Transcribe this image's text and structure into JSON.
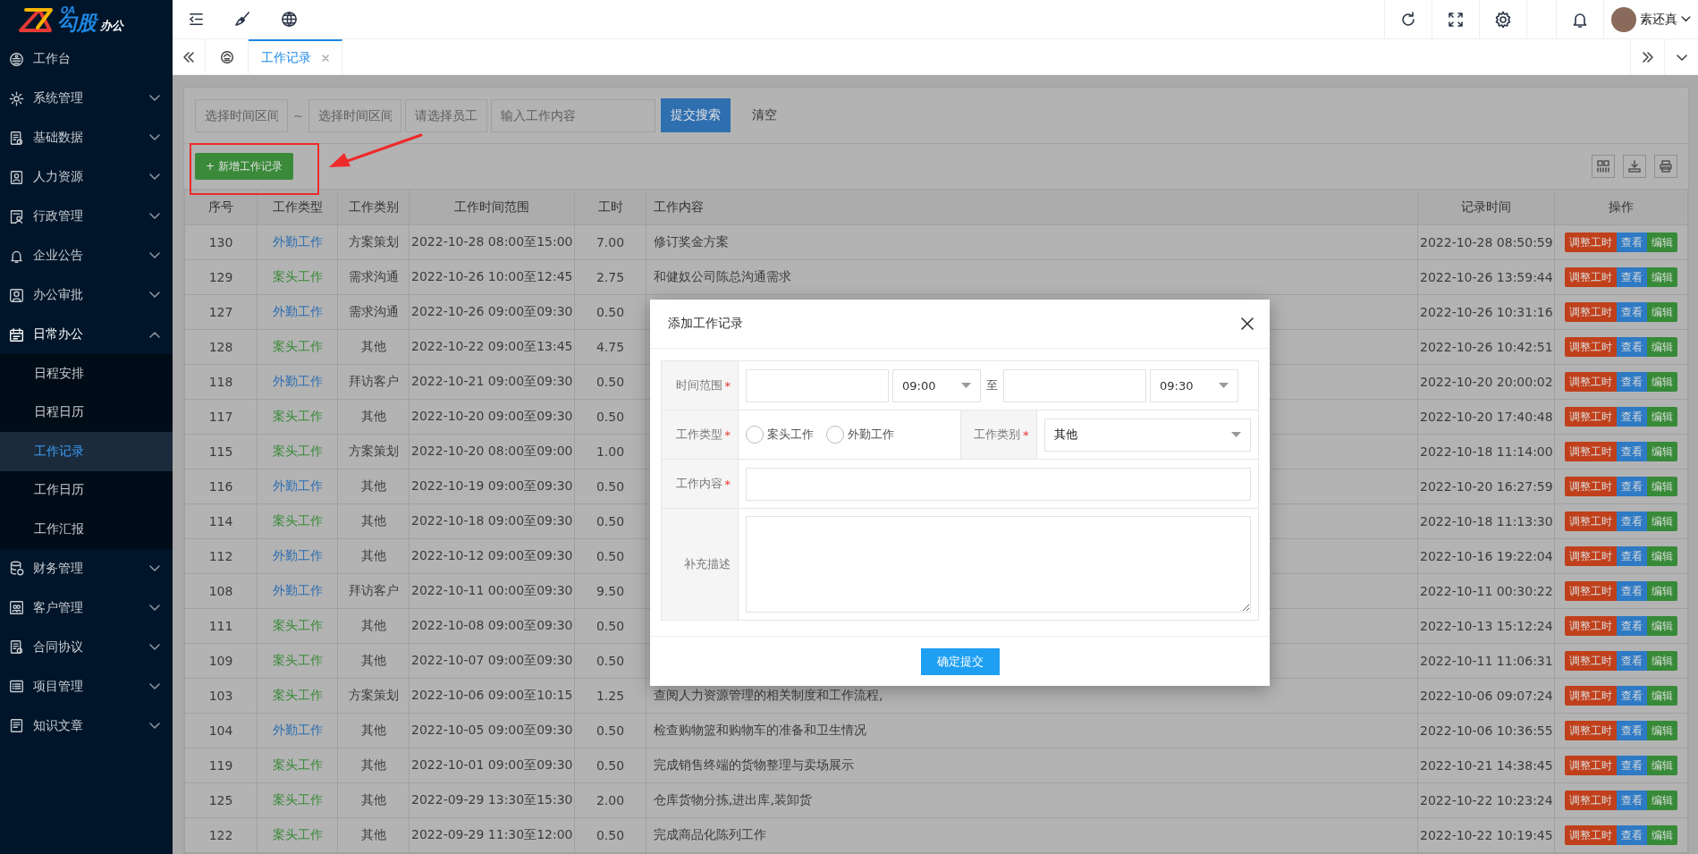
{
  "logo": {
    "mark": "OA",
    "name": "勾股",
    "suffix": "办公"
  },
  "sidebar": {
    "items": [
      {
        "label": "工作台",
        "expanded": false
      },
      {
        "label": "系统管理",
        "expanded": false
      },
      {
        "label": "基础数据",
        "expanded": false
      },
      {
        "label": "人力资源",
        "expanded": false
      },
      {
        "label": "行政管理",
        "expanded": false
      },
      {
        "label": "企业公告",
        "expanded": false
      },
      {
        "label": "办公审批",
        "expanded": false
      },
      {
        "label": "日常办公",
        "expanded": true,
        "children": [
          {
            "label": "日程安排",
            "selected": false
          },
          {
            "label": "日程日历",
            "selected": false
          },
          {
            "label": "工作记录",
            "selected": true
          },
          {
            "label": "工作日历",
            "selected": false
          },
          {
            "label": "工作汇报",
            "selected": false
          }
        ]
      },
      {
        "label": "财务管理",
        "expanded": false
      },
      {
        "label": "客户管理",
        "expanded": false
      },
      {
        "label": "合同协议",
        "expanded": false
      },
      {
        "label": "项目管理",
        "expanded": false
      },
      {
        "label": "知识文章",
        "expanded": false
      }
    ]
  },
  "header": {
    "user": "素还真"
  },
  "tabs": [
    {
      "label": "工作记录",
      "selected": true
    }
  ],
  "filters": {
    "start": {
      "placeholder": "选择时间区间"
    },
    "separator": "~",
    "end": {
      "placeholder": "选择时间区间"
    },
    "employee": {
      "placeholder": "请选择员工"
    },
    "content": {
      "placeholder": "输入工作内容"
    },
    "search_button": "提交搜索",
    "clear_button": "清空"
  },
  "add_button": "+ 新增工作记录",
  "table": {
    "columns": [
      "序号",
      "工作类型",
      "工作类别",
      "工作时间范围",
      "工时",
      "工作内容",
      "记录时间",
      "操作"
    ],
    "rows": [
      {
        "id": "130",
        "type": {
          "text": "外勤工作",
          "color": "#2e6eb0"
        },
        "category": "方案策划",
        "range": "2022-10-28 08:00至15:00",
        "hours": "7.00",
        "content": "修订奖金方案",
        "recorded": "2022-10-28 08:50:59",
        "actions": [
          {
            "label": "调整工时",
            "kind": "adjust"
          },
          {
            "label": "查看",
            "kind": "view"
          },
          {
            "label": "编辑",
            "kind": "edit"
          }
        ]
      },
      {
        "id": "129",
        "type": {
          "text": "案头工作",
          "color": "#3a8a3a"
        },
        "category": "需求沟通",
        "range": "2022-10-26 10:00至12:45",
        "hours": "2.75",
        "content": "和健奴公司陈总沟通需求",
        "recorded": "2022-10-26 13:59:44",
        "actions": [
          {
            "label": "调整工时",
            "kind": "adjust"
          },
          {
            "label": "查看",
            "kind": "view"
          },
          {
            "label": "编辑",
            "kind": "edit"
          }
        ]
      },
      {
        "id": "127",
        "type": {
          "text": "外勤工作",
          "color": "#2e6eb0"
        },
        "category": "需求沟通",
        "range": "2022-10-26 09:00至09:30",
        "hours": "0.50",
        "recorded": "2022-10-26 10:31:16",
        "actions": [
          {
            "label": "调整工时",
            "kind": "adjust"
          },
          {
            "label": "查看",
            "kind": "view"
          },
          {
            "label": "编辑",
            "kind": "edit"
          }
        ]
      },
      {
        "id": "128",
        "type": {
          "text": "案头工作",
          "color": "#3a8a3a"
        },
        "category": "其他",
        "range": "2022-10-22 09:00至13:45",
        "hours": "4.75",
        "recorded": "2022-10-26 10:42:51",
        "actions": [
          {
            "label": "调整工时",
            "kind": "adjust"
          },
          {
            "label": "查看",
            "kind": "view"
          },
          {
            "label": "编辑",
            "kind": "edit"
          }
        ]
      },
      {
        "id": "118",
        "type": {
          "text": "外勤工作",
          "color": "#2e6eb0"
        },
        "category": "拜访客户",
        "range": "2022-10-21 09:00至09:30",
        "hours": "0.50",
        "recorded": "2022-10-20 20:00:02",
        "actions": [
          {
            "label": "调整工时",
            "kind": "adjust"
          },
          {
            "label": "查看",
            "kind": "view"
          },
          {
            "label": "编辑",
            "kind": "edit"
          }
        ]
      },
      {
        "id": "117",
        "type": {
          "text": "案头工作",
          "color": "#3a8a3a"
        },
        "category": "其他",
        "range": "2022-10-20 09:00至09:30",
        "hours": "0.50",
        "recorded": "2022-10-20 17:40:48",
        "actions": [
          {
            "label": "调整工时",
            "kind": "adjust"
          },
          {
            "label": "查看",
            "kind": "view"
          },
          {
            "label": "编辑",
            "kind": "edit"
          }
        ]
      },
      {
        "id": "115",
        "type": {
          "text": "案头工作",
          "color": "#3a8a3a"
        },
        "category": "方案策划",
        "range": "2022-10-20 08:00至09:00",
        "hours": "1.00",
        "recorded": "2022-10-18 11:14:00",
        "actions": [
          {
            "label": "调整工时",
            "kind": "adjust"
          },
          {
            "label": "查看",
            "kind": "view"
          },
          {
            "label": "编辑",
            "kind": "edit"
          }
        ]
      },
      {
        "id": "116",
        "type": {
          "text": "外勤工作",
          "color": "#2e6eb0"
        },
        "category": "其他",
        "range": "2022-10-19 09:00至09:30",
        "hours": "0.50",
        "recorded": "2022-10-20 16:27:59",
        "actions": [
          {
            "label": "调整工时",
            "kind": "adjust"
          },
          {
            "label": "查看",
            "kind": "view"
          },
          {
            "label": "编辑",
            "kind": "edit"
          }
        ]
      },
      {
        "id": "114",
        "type": {
          "text": "案头工作",
          "color": "#3a8a3a"
        },
        "category": "其他",
        "range": "2022-10-18 09:00至09:30",
        "hours": "0.50",
        "recorded": "2022-10-18 11:13:30",
        "actions": [
          {
            "label": "调整工时",
            "kind": "adjust"
          },
          {
            "label": "查看",
            "kind": "view"
          },
          {
            "label": "编辑",
            "kind": "edit"
          }
        ]
      },
      {
        "id": "112",
        "type": {
          "text": "外勤工作",
          "color": "#2e6eb0"
        },
        "category": "其他",
        "range": "2022-10-12 09:00至09:30",
        "hours": "0.50",
        "recorded": "2022-10-16 19:22:04",
        "actions": [
          {
            "label": "调整工时",
            "kind": "adjust"
          },
          {
            "label": "查看",
            "kind": "view"
          },
          {
            "label": "编辑",
            "kind": "edit"
          }
        ]
      },
      {
        "id": "108",
        "type": {
          "text": "外勤工作",
          "color": "#2e6eb0"
        },
        "category": "拜访客户",
        "range": "2022-10-11 00:00至09:30",
        "hours": "9.50",
        "recorded": "2022-10-11 00:30:22",
        "actions": [
          {
            "label": "调整工时",
            "kind": "adjust"
          },
          {
            "label": "查看",
            "kind": "view"
          },
          {
            "label": "编辑",
            "kind": "edit"
          }
        ]
      },
      {
        "id": "111",
        "type": {
          "text": "案头工作",
          "color": "#3a8a3a"
        },
        "category": "其他",
        "range": "2022-10-08 09:00至09:30",
        "hours": "0.50",
        "recorded": "2022-10-13 15:12:24",
        "actions": [
          {
            "label": "调整工时",
            "kind": "adjust"
          },
          {
            "label": "查看",
            "kind": "view"
          },
          {
            "label": "编辑",
            "kind": "edit"
          }
        ]
      },
      {
        "id": "109",
        "type": {
          "text": "案头工作",
          "color": "#3a8a3a"
        },
        "category": "其他",
        "range": "2022-10-07 09:00至09:30",
        "hours": "0.50",
        "recorded": "2022-10-11 11:06:31",
        "actions": [
          {
            "label": "调整工时",
            "kind": "adjust"
          },
          {
            "label": "查看",
            "kind": "view"
          },
          {
            "label": "编辑",
            "kind": "edit"
          }
        ]
      },
      {
        "id": "103",
        "type": {
          "text": "案头工作",
          "color": "#3a8a3a"
        },
        "category": "方案策划",
        "range": "2022-10-06 09:00至10:15",
        "hours": "1.25",
        "content": "查阅人力资源管理的相关制度和工作流程,",
        "recorded": "2022-10-06 09:07:24",
        "actions": [
          {
            "label": "调整工时",
            "kind": "adjust"
          },
          {
            "label": "查看",
            "kind": "view"
          },
          {
            "label": "编辑",
            "kind": "edit"
          }
        ]
      },
      {
        "id": "104",
        "type": {
          "text": "外勤工作",
          "color": "#2e6eb0"
        },
        "category": "其他",
        "range": "2022-10-05 09:00至09:30",
        "hours": "0.50",
        "content": "检查购物篮和购物车的准备和卫生情况",
        "recorded": "2022-10-06 10:36:55",
        "actions": [
          {
            "label": "调整工时",
            "kind": "adjust"
          },
          {
            "label": "查看",
            "kind": "view"
          },
          {
            "label": "编辑",
            "kind": "edit"
          }
        ]
      },
      {
        "id": "119",
        "type": {
          "text": "案头工作",
          "color": "#3a8a3a"
        },
        "category": "其他",
        "range": "2022-10-01 09:00至09:30",
        "hours": "0.50",
        "content": "完成销售终端的货物整理与卖场展示",
        "recorded": "2022-10-21 14:38:45",
        "actions": [
          {
            "label": "调整工时",
            "kind": "adjust"
          },
          {
            "label": "查看",
            "kind": "view"
          },
          {
            "label": "编辑",
            "kind": "edit"
          }
        ]
      },
      {
        "id": "125",
        "type": {
          "text": "案头工作",
          "color": "#3a8a3a"
        },
        "category": "其他",
        "range": "2022-09-29 13:30至15:30",
        "hours": "2.00",
        "content": "仓库货物分拣,进出库,装卸货",
        "recorded": "2022-10-22 10:23:24",
        "actions": [
          {
            "label": "调整工时",
            "kind": "adjust"
          },
          {
            "label": "查看",
            "kind": "view"
          },
          {
            "label": "编辑",
            "kind": "edit"
          }
        ]
      },
      {
        "id": "122",
        "type": {
          "text": "案头工作",
          "color": "#3a8a3a"
        },
        "category": "其他",
        "range": "2022-09-29 11:30至12:00",
        "hours": "0.50",
        "content": "完成商品化陈列工作",
        "recorded": "2022-10-22 10:19:45",
        "actions": [
          {
            "label": "调整工时",
            "kind": "adjust"
          },
          {
            "label": "查看",
            "kind": "view"
          },
          {
            "label": "编辑",
            "kind": "edit"
          }
        ]
      }
    ]
  },
  "modal": {
    "title": "添加工作记录",
    "time_range": {
      "label": "时间范围",
      "required_mark": "*",
      "start_time": "09:00",
      "separator": "至",
      "end_time": "09:30"
    },
    "work_type": {
      "label": "工作类型",
      "required_mark": "*",
      "options": [
        {
          "label": "案头工作",
          "selected": false
        },
        {
          "label": "外勤工作",
          "selected": false
        }
      ]
    },
    "category": {
      "label": "工作类别",
      "required_mark": "*",
      "value": "其他"
    },
    "content": {
      "label": "工作内容",
      "required_mark": "*"
    },
    "description": {
      "label": "补充描述"
    },
    "submit": "确定提交"
  }
}
